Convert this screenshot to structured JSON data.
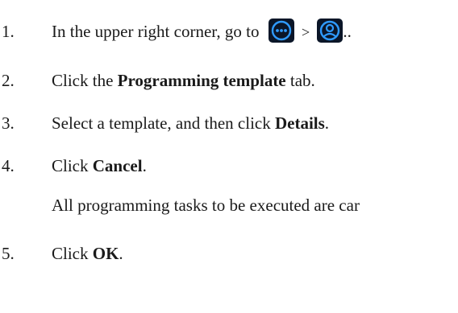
{
  "steps": [
    {
      "number": "1.",
      "text_before": "In the upper right corner, go to",
      "separator": ">",
      "text_after": ".."
    },
    {
      "number": "2.",
      "before": "Click the ",
      "bold": "Programming template",
      "after": " tab."
    },
    {
      "number": "3.",
      "before": "Select a template, and then click ",
      "bold": "Details",
      "after": "."
    },
    {
      "number": "4.",
      "before": "Click ",
      "bold": "Cancel",
      "after": "."
    },
    {
      "number": "5.",
      "before": "Click ",
      "bold": "OK",
      "after": "."
    }
  ],
  "note_text": "All programming tasks to be executed are car",
  "icons": {
    "more": "more-options-icon",
    "user": "user-account-icon",
    "accent": "#2f9bff",
    "button_bg": "#0b1628"
  }
}
